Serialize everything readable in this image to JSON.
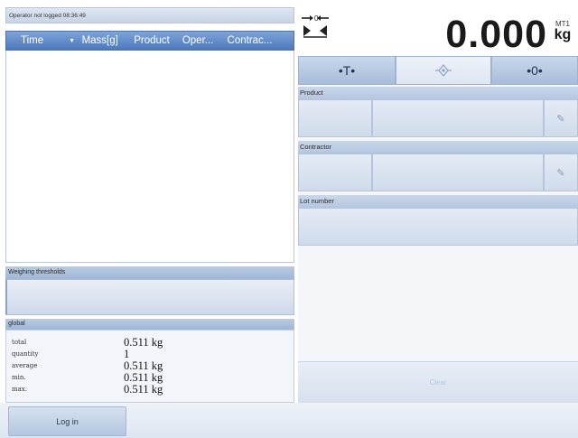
{
  "status": {
    "text": "Operator not logged 08:36:49"
  },
  "grid": {
    "columns": [
      "Time",
      "Mass[g]",
      "Product",
      "Oper...",
      "Contrac..."
    ],
    "sort_indicator": "▼",
    "rows": []
  },
  "thresholds": {
    "label": "Weighing thresholds"
  },
  "global": {
    "label": "global",
    "stats": [
      {
        "label": "total",
        "value": "0.511 kg"
      },
      {
        "label": "quantity",
        "value": "1"
      },
      {
        "label": "average",
        "value": "0.511 kg"
      },
      {
        "label": "min.",
        "value": "0.511 kg"
      },
      {
        "label": "max.",
        "value": "0.511 kg"
      }
    ]
  },
  "display": {
    "value": "0.000",
    "unit": "kg",
    "unit_sub": "MT1"
  },
  "keys": {
    "tare": "•T•",
    "print_icon": "print-icon",
    "zero": "•0•"
  },
  "fields": {
    "product_label": "Product",
    "contractor_label": "Contractor",
    "lot_label": "Lot number"
  },
  "buttons": {
    "clear": "Clear",
    "login": "Log in"
  },
  "colors": {
    "accent": "#4b78bd",
    "panel": "#cfdbeb"
  }
}
